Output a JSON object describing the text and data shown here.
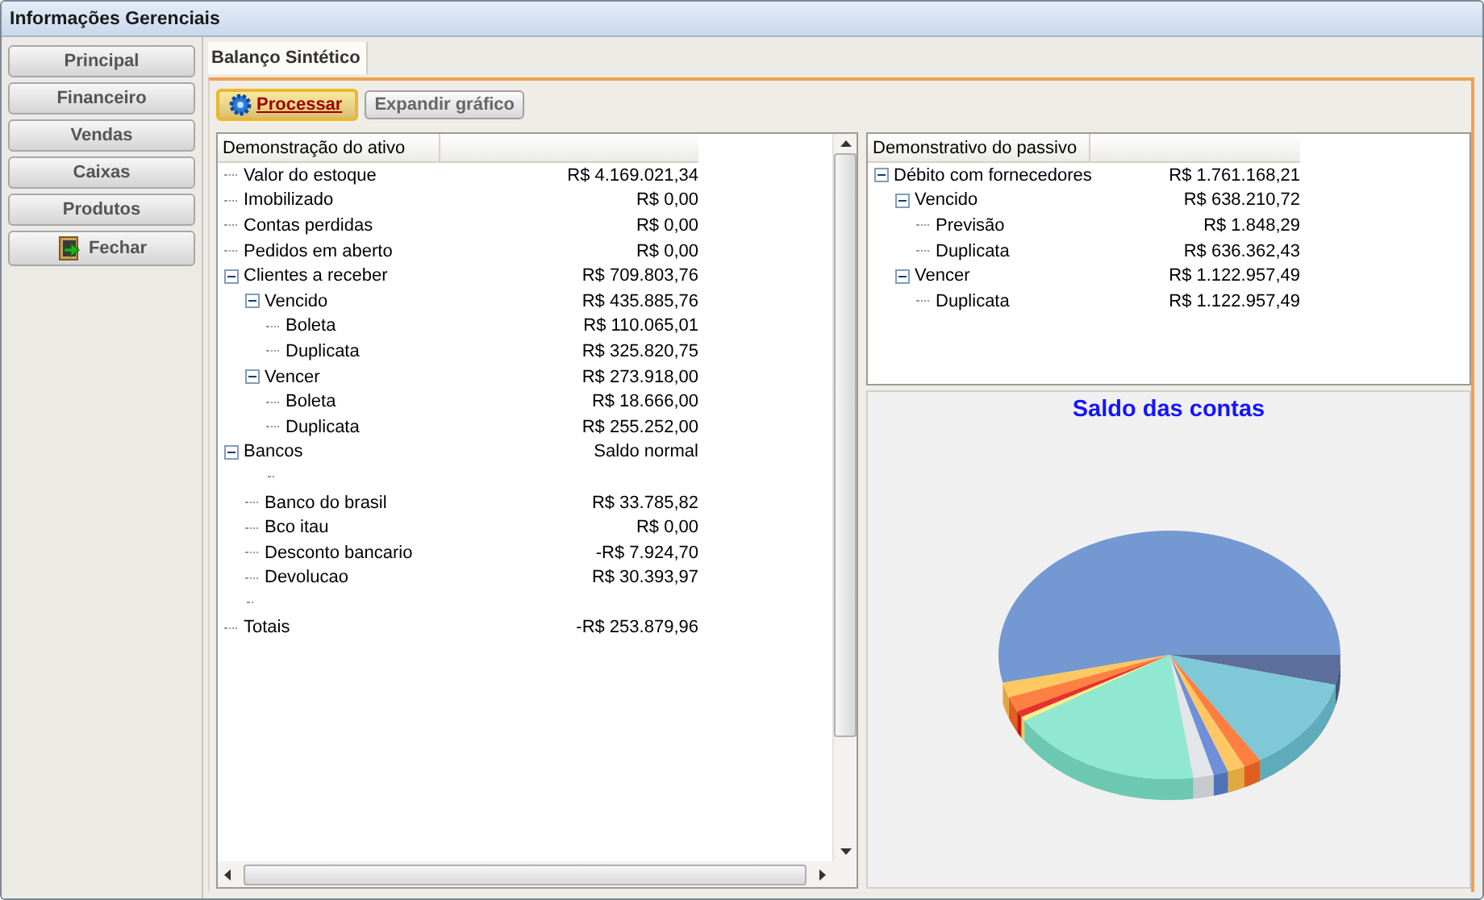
{
  "window": {
    "title": "Informações Gerenciais"
  },
  "sidebar": {
    "buttons": [
      {
        "label": "Principal",
        "kind": "text"
      },
      {
        "label": "Financeiro",
        "kind": "text"
      },
      {
        "label": "Vendas",
        "kind": "text"
      },
      {
        "label": "Caixas",
        "kind": "text"
      },
      {
        "label": "Produtos",
        "kind": "text"
      },
      {
        "label": "Fechar",
        "kind": "exit"
      }
    ]
  },
  "tabs": [
    {
      "label": "Balanço Sintético",
      "selected": true
    }
  ],
  "toolbar": {
    "buttons": [
      {
        "label": "Processar",
        "kind": "default"
      },
      {
        "label": "Expandir gráfico",
        "kind": "normal"
      }
    ]
  },
  "assets_tree": {
    "column": "Demonstração do ativo",
    "rows": [
      {
        "kind": "item",
        "label": "Valor do estoque",
        "value": "R$ 4.169.021,34"
      },
      {
        "kind": "item",
        "label": "Imobilizado",
        "value": "R$ 0,00"
      },
      {
        "kind": "item",
        "label": "Contas perdidas",
        "value": "R$ 0,00"
      },
      {
        "kind": "item",
        "label": "Pedidos em aberto",
        "value": "R$ 0,00"
      },
      {
        "kind": "item",
        "label": "Clientes a receber",
        "value": "R$ 709.803,76",
        "expanded": true,
        "children": [
          {
            "kind": "item",
            "label": "Vencido",
            "value": "R$ 435.885,76",
            "expanded": true,
            "children": [
              {
                "kind": "item",
                "label": "Boleta",
                "value": "R$ 110.065,01"
              },
              {
                "kind": "item",
                "label": "Duplicata",
                "value": "R$ 325.820,75"
              }
            ]
          },
          {
            "kind": "item",
            "label": "Vencer",
            "value": "R$ 273.918,00",
            "expanded": true,
            "children": [
              {
                "kind": "item",
                "label": "Boleta",
                "value": "R$ 18.666,00"
              },
              {
                "kind": "item",
                "label": "Duplicata",
                "value": "R$ 255.252,00"
              }
            ]
          }
        ]
      },
      {
        "kind": "item",
        "label": "Bancos",
        "value": "Saldo normal",
        "expanded": true,
        "children": [
          {
            "kind": "blank"
          },
          {
            "kind": "item",
            "label": "Banco do brasil",
            "value": "R$ 33.785,82"
          },
          {
            "kind": "item",
            "label": "Bco itau",
            "value": "R$ 0,00"
          },
          {
            "kind": "item",
            "label": "Desconto bancario",
            "value": "-R$ 7.924,70"
          },
          {
            "kind": "item",
            "label": "Devolucao",
            "value": "R$ 30.393,97"
          }
        ]
      },
      {
        "kind": "blank"
      },
      {
        "kind": "item",
        "label": "Totais",
        "value": "-R$ 253.879,96"
      }
    ]
  },
  "liabilities_tree": {
    "column": "Demonstrativo do passivo",
    "rows": [
      {
        "kind": "item",
        "label": "Débito com fornecedores",
        "value": "R$ 1.761.168,21",
        "expanded": true,
        "children": [
          {
            "kind": "item",
            "label": "Vencido",
            "value": "R$ 638.210,72",
            "expanded": true,
            "children": [
              {
                "kind": "item",
                "label": "Previsão",
                "value": "R$ 1.848,29"
              },
              {
                "kind": "item",
                "label": "Duplicata",
                "value": "R$ 636.362,43"
              }
            ]
          },
          {
            "kind": "item",
            "label": "Vencer",
            "value": "R$ 1.122.957,49",
            "expanded": true,
            "children": [
              {
                "kind": "item",
                "label": "Duplicata",
                "value": "R$ 1.122.957,49"
              }
            ]
          }
        ]
      }
    ]
  },
  "chart": {
    "title": "Saldo das contas"
  }
}
